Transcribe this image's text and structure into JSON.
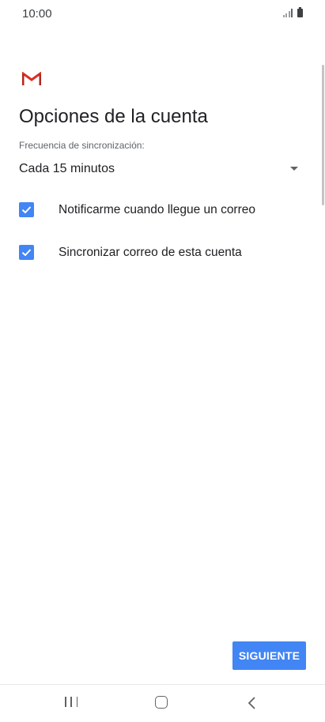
{
  "status_bar": {
    "time": "10:00",
    "icons": [
      "signal-icon",
      "battery-icon"
    ]
  },
  "app": {
    "logo_icon": "gmail-logo-icon",
    "title": "Opciones de la cuenta"
  },
  "sync": {
    "label": "Frecuencia de sincronización:",
    "selected_value": "Cada 15 minutos"
  },
  "options": [
    {
      "label": "Notificarme cuando llegue un correo",
      "checked": true
    },
    {
      "label": "Sincronizar correo de esta cuenta",
      "checked": true
    }
  ],
  "actions": {
    "next_label": "SIGUIENTE"
  },
  "nav_bar": {
    "icons": [
      "recent-apps-icon",
      "home-icon",
      "back-icon"
    ]
  },
  "colors": {
    "accent": "#4285f4",
    "gmail_red": "#d93025"
  }
}
